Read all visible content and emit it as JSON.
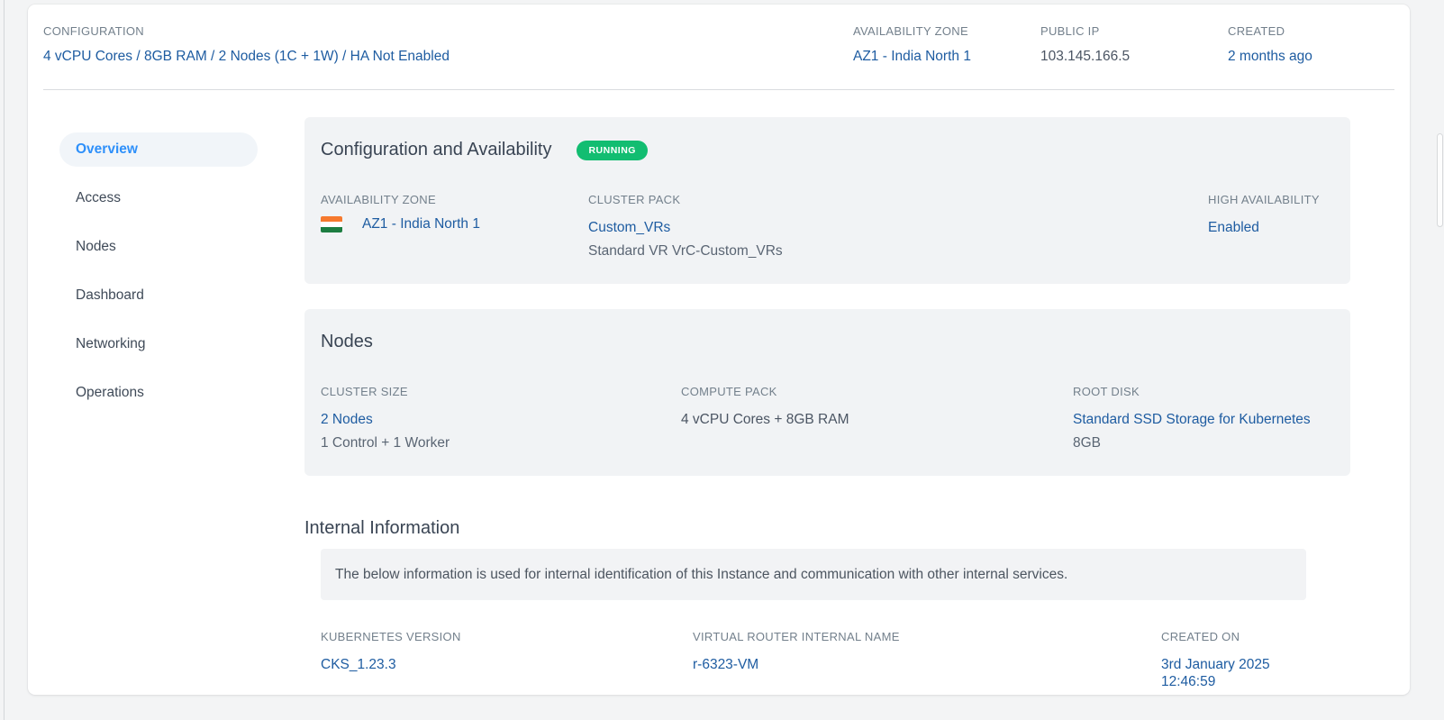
{
  "header": {
    "configuration": {
      "label": "CONFIGURATION",
      "value": "4 vCPU Cores / 8GB RAM / 2 Nodes (1C + 1W) / HA Not Enabled"
    },
    "availability_zone": {
      "label": "AVAILABILITY ZONE",
      "value": "AZ1 - India North 1"
    },
    "public_ip": {
      "label": "PUBLIC IP",
      "value": "103.145.166.5"
    },
    "created": {
      "label": "CREATED",
      "value": "2 months ago"
    }
  },
  "sidebar": {
    "items": [
      {
        "label": "Overview",
        "active": true
      },
      {
        "label": "Access",
        "active": false
      },
      {
        "label": "Nodes",
        "active": false
      },
      {
        "label": "Dashboard",
        "active": false
      },
      {
        "label": "Networking",
        "active": false
      },
      {
        "label": "Operations",
        "active": false
      }
    ]
  },
  "sections": {
    "config_availability": {
      "title": "Configuration and Availability",
      "status_badge": "RUNNING",
      "fields": {
        "availability_zone": {
          "label": "AVAILABILITY ZONE",
          "value": "AZ1 - India North 1",
          "flag": "india-flag"
        },
        "cluster_pack": {
          "label": "CLUSTER PACK",
          "value": "Custom_VRs",
          "sub": "Standard VR VrC-Custom_VRs"
        },
        "high_availability": {
          "label": "HIGH AVAILABILITY",
          "value": "Enabled"
        }
      }
    },
    "nodes": {
      "title": "Nodes",
      "fields": {
        "cluster_size": {
          "label": "CLUSTER SIZE",
          "value": "2 Nodes",
          "sub": "1 Control + 1 Worker"
        },
        "compute_pack": {
          "label": "COMPUTE PACK",
          "value": "4 vCPU Cores + 8GB RAM"
        },
        "root_disk": {
          "label": "ROOT DISK",
          "value": "Standard SSD Storage for Kubernetes",
          "sub": "8GB"
        }
      }
    },
    "internal_info": {
      "title": "Internal Information",
      "note": "The below information is used for internal identification of this Instance and communication with other internal services.",
      "fields": {
        "kubernetes_version": {
          "label": "KUBERNETES VERSION",
          "value": "CKS_1.23.3"
        },
        "virtual_router": {
          "label": "VIRTUAL ROUTER INTERNAL NAME",
          "value": "r-6323-VM"
        },
        "created_on": {
          "label": "CREATED ON",
          "value": "3rd January 2025 12:46:59"
        }
      }
    }
  },
  "status": {
    "state": "RUNNING",
    "color": "#12bd71"
  },
  "colors": {
    "link_blue": "#1e5ca1",
    "active_tab_blue": "#2e90fa",
    "section_bg": "#f1f3f5",
    "badge_green": "#12bd71",
    "flag_saffron": "#f6792e",
    "flag_green": "#1d7d41"
  }
}
